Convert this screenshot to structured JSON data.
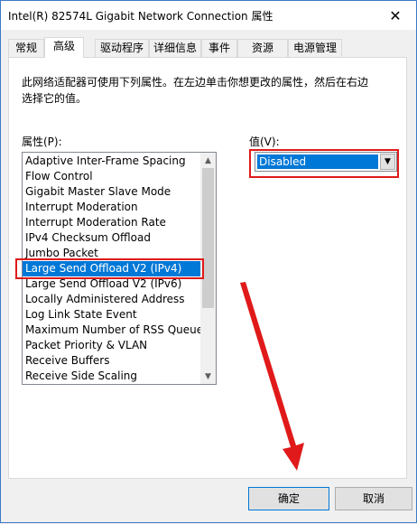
{
  "window": {
    "title": "Intel(R) 82574L Gigabit Network Connection 属性",
    "close_glyph": "✕"
  },
  "tabs": [
    {
      "label": "常规"
    },
    {
      "label": "高级"
    },
    {
      "label": "驱动程序"
    },
    {
      "label": "详细信息"
    },
    {
      "label": "事件"
    },
    {
      "label": "资源"
    },
    {
      "label": "电源管理"
    }
  ],
  "active_tab": "高级",
  "panel": {
    "description": "此网络适配器可使用下列属性。在左边单击你想更改的属性，然后在右边选择它的值。",
    "property_label": "属性(P):",
    "value_label": "值(V):"
  },
  "properties": [
    "Adaptive Inter-Frame Spacing",
    "Flow Control",
    "Gigabit Master Slave Mode",
    "Interrupt Moderation",
    "Interrupt Moderation Rate",
    "IPv4 Checksum Offload",
    "Jumbo Packet",
    "Large Send Offload V2 (IPv4)",
    "Large Send Offload V2 (IPv6)",
    "Locally Administered Address",
    "Log Link State Event",
    "Maximum Number of RSS Queue",
    "Packet Priority & VLAN",
    "Receive Buffers",
    "Receive Side Scaling"
  ],
  "selected_property": "Large Send Offload V2 (IPv4)",
  "value": {
    "selected": "Disabled"
  },
  "buttons": {
    "ok": "确定",
    "cancel": "取消"
  },
  "icons": {
    "scroll_up": "▲",
    "scroll_down": "▼",
    "dropdown": "▼"
  },
  "colors": {
    "accent": "#0078d7",
    "annotation_red": "#e01a1a"
  }
}
